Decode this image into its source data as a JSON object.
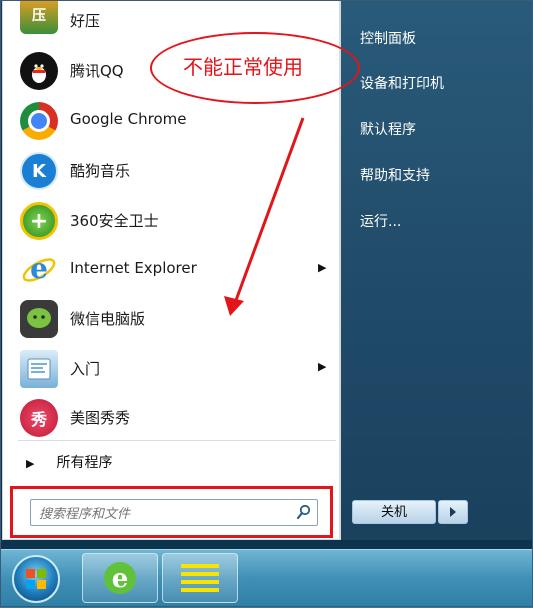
{
  "programs": [
    {
      "label": "好压",
      "icon": "haozip-icon",
      "color": "#3a8f3a",
      "glyph": "压"
    },
    {
      "label": "腾讯QQ",
      "icon": "qq-penguin-icon",
      "color": "#111111",
      "glyph": "Q"
    },
    {
      "label": "Google Chrome",
      "icon": "chrome-icon",
      "color": "#d93025",
      "glyph": "●"
    },
    {
      "label": "酷狗音乐",
      "icon": "kugou-icon",
      "color": "#1a7fd4",
      "glyph": "K"
    },
    {
      "label": "360安全卫士",
      "icon": "360-shield-icon",
      "color": "#36a829",
      "glyph": "+"
    },
    {
      "label": "Internet Explorer",
      "icon": "ie-icon",
      "color": "#2c8ad8",
      "glyph": "e",
      "submenu": true
    },
    {
      "label": "微信电脑版",
      "icon": "wechat-icon",
      "color": "#555555",
      "glyph": "•"
    },
    {
      "label": "入门",
      "icon": "getting-started-icon",
      "color": "#7ab1d8",
      "glyph": "▤",
      "submenu": true
    },
    {
      "label": "美图秀秀",
      "icon": "meitu-icon",
      "color": "#d8284a",
      "glyph": "秀"
    }
  ],
  "all_programs": "所有程序",
  "search": {
    "placeholder": "搜索程序和文件"
  },
  "right_items": [
    "控制面板",
    "设备和打印机",
    "默认程序",
    "帮助和支持",
    "运行..."
  ],
  "shutdown_label": "关机",
  "annotation": "不能正常使用",
  "colors": {
    "annotation": "#e2151b",
    "taskbar": "#3f8fb6"
  }
}
